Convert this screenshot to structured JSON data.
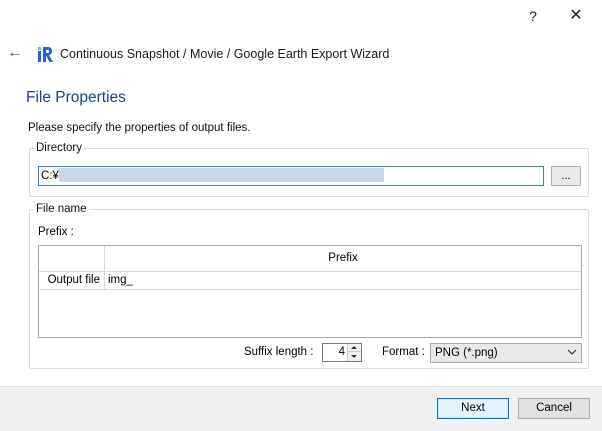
{
  "titlebar": {
    "help_label": "?",
    "close_label": "✕"
  },
  "header": {
    "back_label": "←",
    "wizard_title": "Continuous Snapshot / Movie / Google Earth Export Wizard"
  },
  "page": {
    "title": "File Properties",
    "description": "Please specify the properties of output files."
  },
  "directory": {
    "legend": "Directory",
    "value_prefix": "C:¥",
    "browse_label": "..."
  },
  "file_name": {
    "legend": "File name",
    "prefix_label": "Prefix :",
    "table": {
      "column_header": "Prefix",
      "row_header": "Output file",
      "cell_value": "img_"
    },
    "suffix_label": "Suffix length :",
    "suffix_value": "4",
    "format_label": "Format :",
    "format_value": "PNG (*.png)"
  },
  "footer": {
    "next_label": "Next",
    "cancel_label": "Cancel"
  },
  "colors": {
    "title_blue": "#1f3f8f",
    "accent": "#0078d7"
  }
}
